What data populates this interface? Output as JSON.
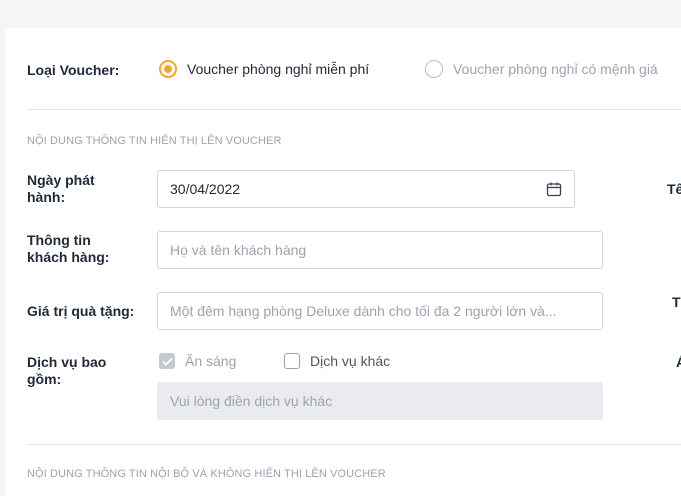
{
  "voucher_type": {
    "label": "Loại Voucher:",
    "options": [
      {
        "label": "Voucher phòng nghỉ miễn phí",
        "selected": true
      },
      {
        "label": "Voucher phòng nghỉ có mệnh giá",
        "selected": false
      }
    ]
  },
  "section_display": {
    "title": "NỘI DUNG THÔNG TIN HIỂN THỊ LÊN VOUCHER"
  },
  "issue_date": {
    "label_line1": "Ngày phát",
    "label_line2": "hành:",
    "value": "30/04/2022"
  },
  "customer_info": {
    "label_line1": "Thông tin",
    "label_line2": "khách hàng:",
    "placeholder": "Họ và tên khách hàng"
  },
  "gift_value": {
    "label": "Giá trị quà tặng:",
    "placeholder": "Một đêm hạng phòng Deluxe dành cho tối đa 2 người lớn và..."
  },
  "services": {
    "label_line1": "Dịch vụ bao",
    "label_line2": "gồm:",
    "breakfast": {
      "label": "Ăn sáng",
      "checked": true
    },
    "other": {
      "label": "Dịch vụ khác",
      "checked": false
    },
    "other_placeholder": "Vui lòng điền dịch vụ khác"
  },
  "right_column_cut": {
    "label1": "Tê",
    "label2": "T",
    "label3": "Á"
  },
  "section_internal": {
    "title": "NỘI DUNG THÔNG TIN NỘI BỘ VÀ KHÔNG HIỂN THỊ LÊN VOUCHER"
  },
  "colors": {
    "accent": "#f5a623",
    "background": "#f4f5f7",
    "card": "#ffffff",
    "muted_text": "#9ca3af",
    "disabled_field": "#e9ebee"
  }
}
